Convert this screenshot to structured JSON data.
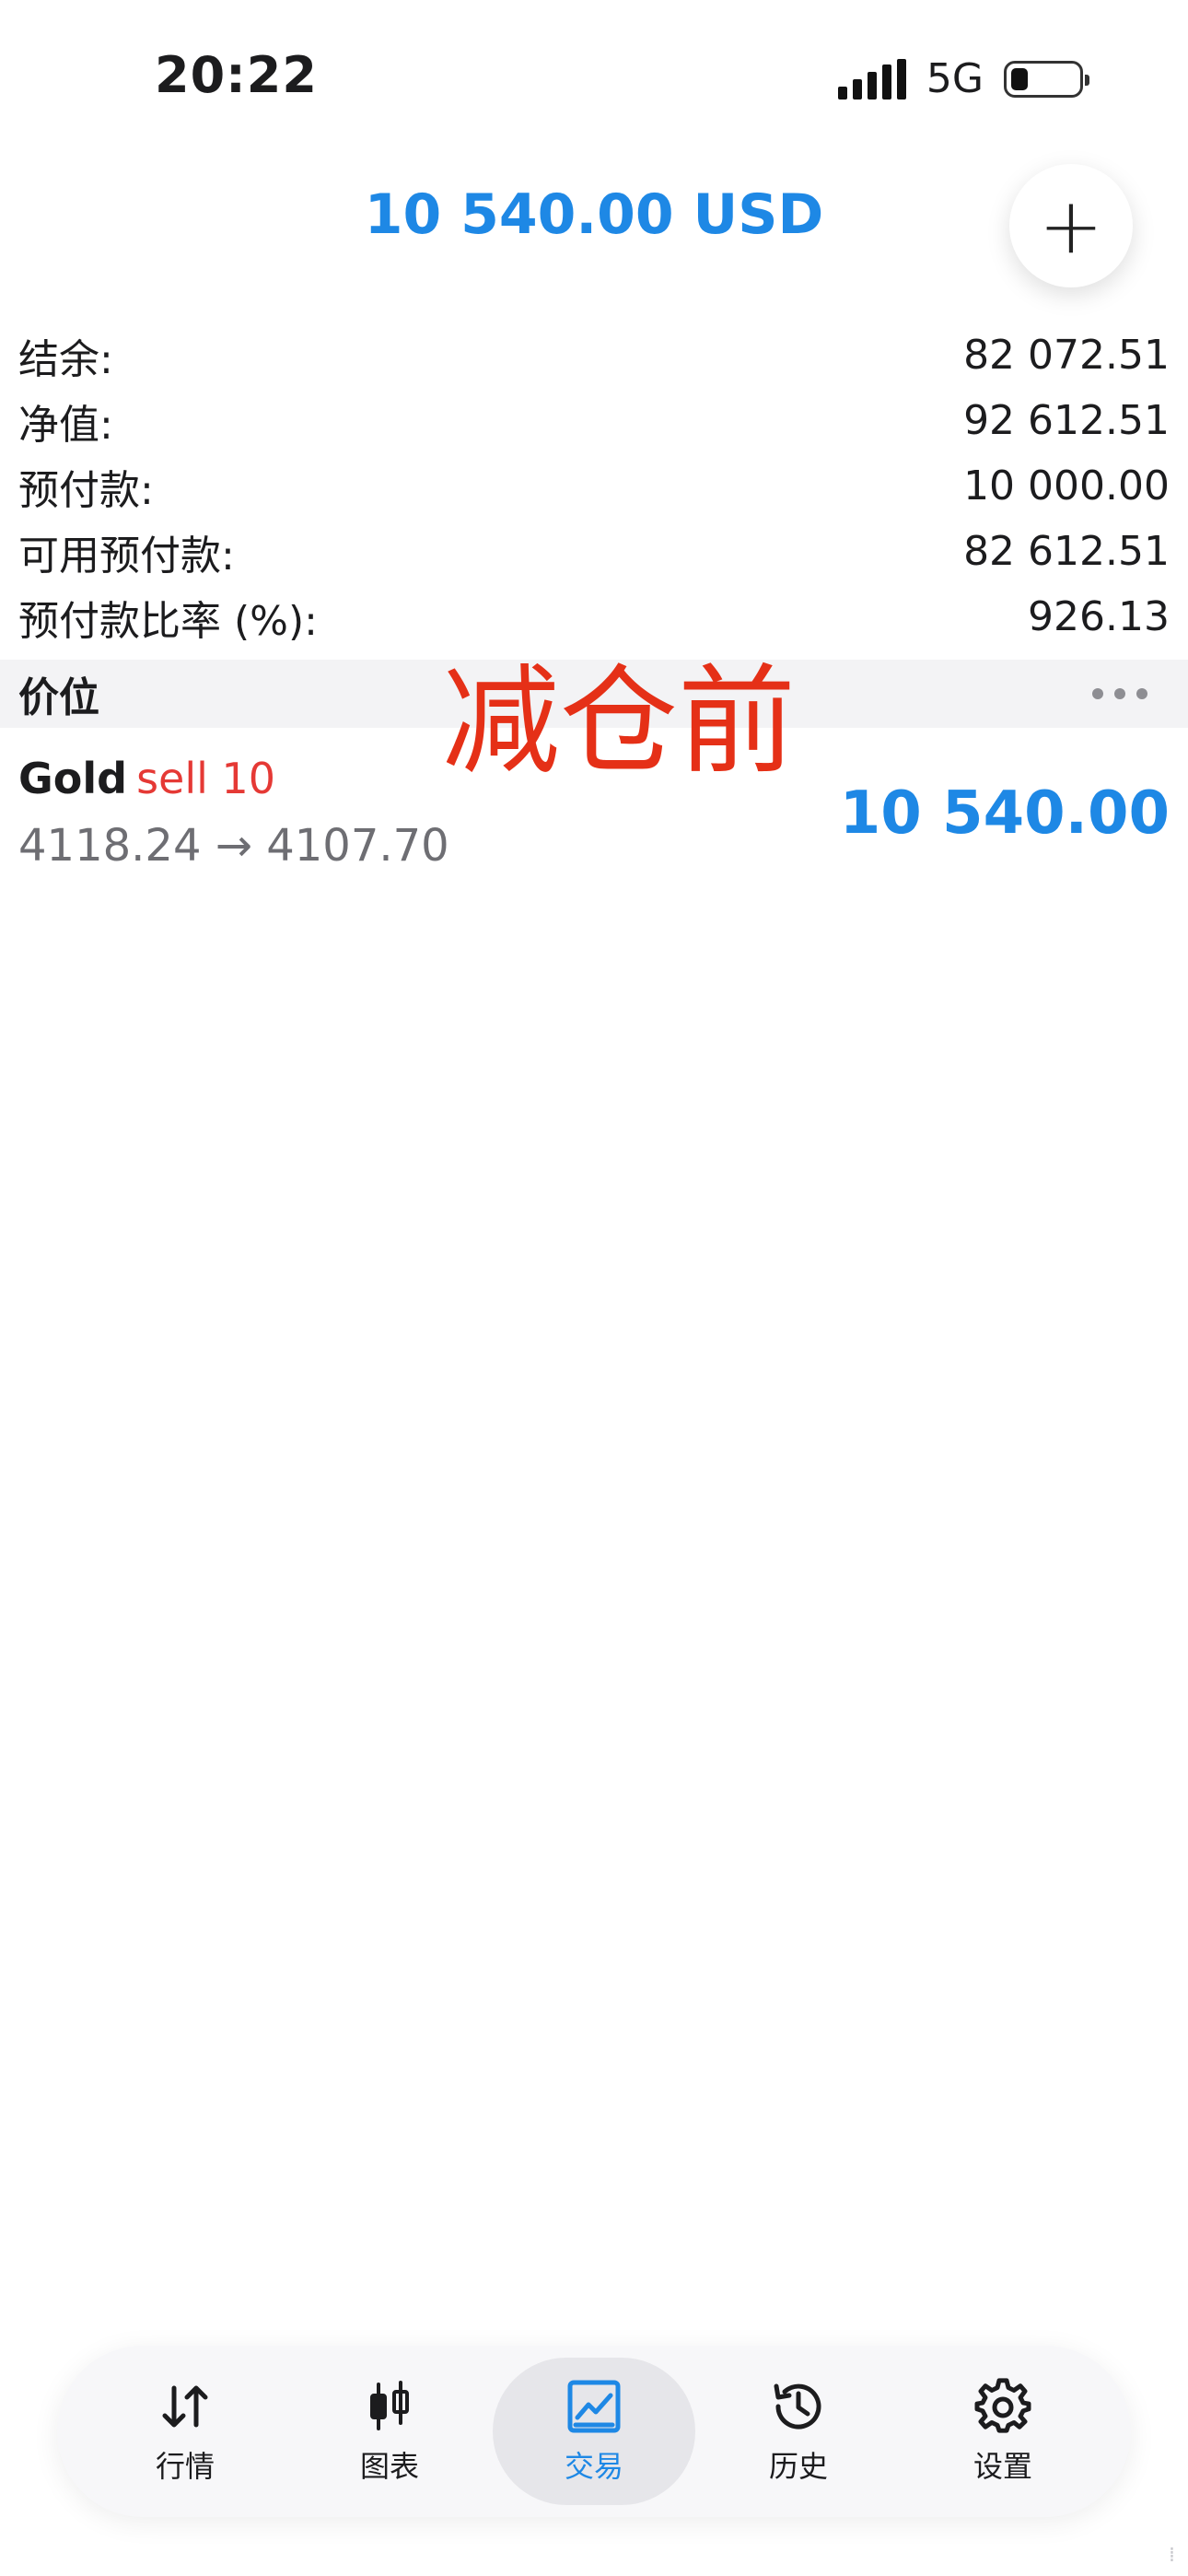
{
  "status_bar": {
    "time": "20:22",
    "network": "5G"
  },
  "header": {
    "total": "10 540.00 USD",
    "add_icon": "plus-icon"
  },
  "summary": [
    {
      "label": "结余:",
      "value": "82 072.51"
    },
    {
      "label": "净值:",
      "value": "92 612.51"
    },
    {
      "label": "预付款:",
      "value": "10 000.00"
    },
    {
      "label": "可用预付款:",
      "value": "82 612.51"
    },
    {
      "label": "预付款比率 (%):",
      "value": "926.13"
    }
  ],
  "section": {
    "title": "价位",
    "more_icon": "more-dots-icon"
  },
  "overlay_text": "减仓前",
  "position": {
    "symbol": "Gold",
    "direction": "sell 10",
    "prices": "4118.24 → 4107.70",
    "profit": "10 540.00"
  },
  "tabbar": {
    "items": [
      {
        "label": "行情",
        "icon": "arrows-up-down-icon"
      },
      {
        "label": "图表",
        "icon": "candlestick-icon"
      },
      {
        "label": "交易",
        "icon": "trade-chart-icon",
        "active": true
      },
      {
        "label": "历史",
        "icon": "history-icon"
      },
      {
        "label": "设置",
        "icon": "gear-icon"
      }
    ]
  },
  "colors": {
    "accent": "#1e88e5",
    "sell": "#e53935",
    "overlay": "#e53017"
  }
}
